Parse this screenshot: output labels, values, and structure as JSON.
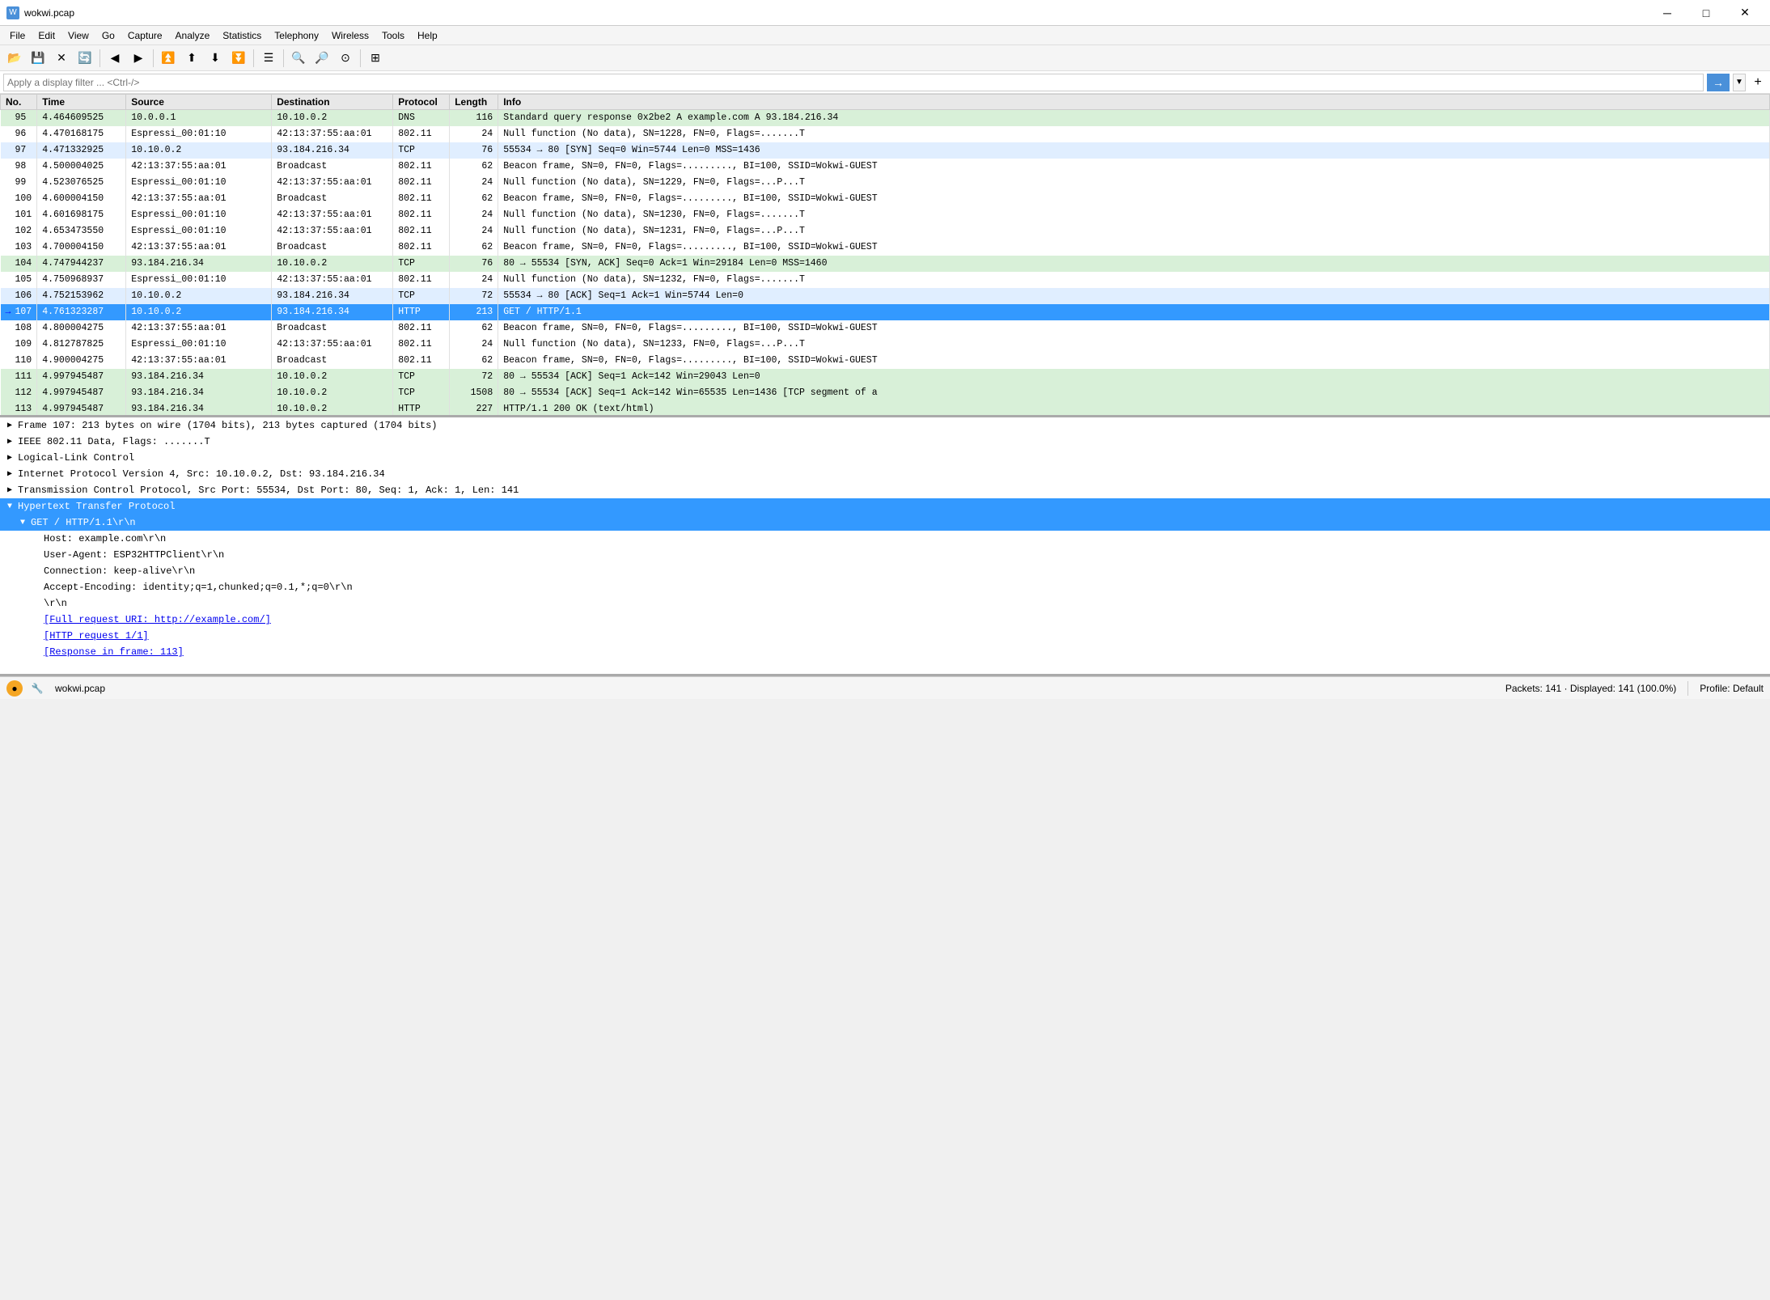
{
  "titlebar": {
    "title": "wokwi.pcap",
    "icon": "W",
    "minimize": "─",
    "maximize": "□",
    "close": "✕"
  },
  "menubar": {
    "items": [
      "File",
      "Edit",
      "View",
      "Go",
      "Capture",
      "Analyze",
      "Statistics",
      "Telephony",
      "Wireless",
      "Tools",
      "Help"
    ]
  },
  "toolbar": {
    "buttons": [
      "📂",
      "💾",
      "✕",
      "🔄",
      "⬅",
      "➡",
      "⬇",
      "⬆",
      "⬇",
      "☰",
      "🔍",
      "🔍",
      "🔍",
      "⊞"
    ]
  },
  "filter": {
    "placeholder": "Apply a display filter ... <Ctrl-/>",
    "value": "",
    "arrow_label": "→",
    "dropdown_label": "▼",
    "add_label": "+"
  },
  "columns": [
    "No.",
    "Time",
    "Source",
    "Destination",
    "Protocol",
    "Length",
    "Info"
  ],
  "packets": [
    {
      "no": "95",
      "time": "4.464609525",
      "src": "10.0.0.1",
      "dst": "10.10.0.2",
      "proto": "DNS",
      "len": "116",
      "info": "Standard query response 0x2be2 A example.com A 93.184.216.34",
      "color": "green",
      "arrow": ""
    },
    {
      "no": "96",
      "time": "4.470168175",
      "src": "Espressi_00:01:10",
      "dst": "42:13:37:55:aa:01",
      "proto": "802.11",
      "len": "24",
      "info": "Null function (No data), SN=1228, FN=0, Flags=.......T",
      "color": "white",
      "arrow": ""
    },
    {
      "no": "97",
      "time": "4.471332925",
      "src": "10.10.0.2",
      "dst": "93.184.216.34",
      "proto": "TCP",
      "len": "76",
      "info": "55534 → 80 [SYN] Seq=0 Win=5744 Len=0 MSS=1436",
      "color": "blue",
      "arrow": ""
    },
    {
      "no": "98",
      "time": "4.500004025",
      "src": "42:13:37:55:aa:01",
      "dst": "Broadcast",
      "proto": "802.11",
      "len": "62",
      "info": "Beacon frame, SN=0, FN=0, Flags=........., BI=100, SSID=Wokwi-GUEST",
      "color": "white",
      "arrow": ""
    },
    {
      "no": "99",
      "time": "4.523076525",
      "src": "Espressi_00:01:10",
      "dst": "42:13:37:55:aa:01",
      "proto": "802.11",
      "len": "24",
      "info": "Null function (No data), SN=1229, FN=0, Flags=...P...T",
      "color": "white",
      "arrow": ""
    },
    {
      "no": "100",
      "time": "4.600004150",
      "src": "42:13:37:55:aa:01",
      "dst": "Broadcast",
      "proto": "802.11",
      "len": "62",
      "info": "Beacon frame, SN=0, FN=0, Flags=........., BI=100, SSID=Wokwi-GUEST",
      "color": "white",
      "arrow": ""
    },
    {
      "no": "101",
      "time": "4.601698175",
      "src": "Espressi_00:01:10",
      "dst": "42:13:37:55:aa:01",
      "proto": "802.11",
      "len": "24",
      "info": "Null function (No data), SN=1230, FN=0, Flags=.......T",
      "color": "white",
      "arrow": ""
    },
    {
      "no": "102",
      "time": "4.653473550",
      "src": "Espressi_00:01:10",
      "dst": "42:13:37:55:aa:01",
      "proto": "802.11",
      "len": "24",
      "info": "Null function (No data), SN=1231, FN=0, Flags=...P...T",
      "color": "white",
      "arrow": ""
    },
    {
      "no": "103",
      "time": "4.700004150",
      "src": "42:13:37:55:aa:01",
      "dst": "Broadcast",
      "proto": "802.11",
      "len": "62",
      "info": "Beacon frame, SN=0, FN=0, Flags=........., BI=100, SSID=Wokwi-GUEST",
      "color": "white",
      "arrow": ""
    },
    {
      "no": "104",
      "time": "4.747944237",
      "src": "93.184.216.34",
      "dst": "10.10.0.2",
      "proto": "TCP",
      "len": "76",
      "info": "80 → 55534 [SYN, ACK] Seq=0 Ack=1 Win=29184 Len=0 MSS=1460",
      "color": "green",
      "arrow": ""
    },
    {
      "no": "105",
      "time": "4.750968937",
      "src": "Espressi_00:01:10",
      "dst": "42:13:37:55:aa:01",
      "proto": "802.11",
      "len": "24",
      "info": "Null function (No data), SN=1232, FN=0, Flags=.......T",
      "color": "white",
      "arrow": ""
    },
    {
      "no": "106",
      "time": "4.752153962",
      "src": "10.10.0.2",
      "dst": "93.184.216.34",
      "proto": "TCP",
      "len": "72",
      "info": "55534 → 80 [ACK] Seq=1 Ack=1 Win=5744 Len=0",
      "color": "blue",
      "arrow": ""
    },
    {
      "no": "107",
      "time": "4.761323287",
      "src": "10.10.0.2",
      "dst": "93.184.216.34",
      "proto": "HTTP",
      "len": "213",
      "info": "GET / HTTP/1.1",
      "color": "selected",
      "arrow": "→"
    },
    {
      "no": "108",
      "time": "4.800004275",
      "src": "42:13:37:55:aa:01",
      "dst": "Broadcast",
      "proto": "802.11",
      "len": "62",
      "info": "Beacon frame, SN=0, FN=0, Flags=........., BI=100, SSID=Wokwi-GUEST",
      "color": "white",
      "arrow": ""
    },
    {
      "no": "109",
      "time": "4.812787825",
      "src": "Espressi_00:01:10",
      "dst": "42:13:37:55:aa:01",
      "proto": "802.11",
      "len": "24",
      "info": "Null function (No data), SN=1233, FN=0, Flags=...P...T",
      "color": "white",
      "arrow": ""
    },
    {
      "no": "110",
      "time": "4.900004275",
      "src": "42:13:37:55:aa:01",
      "dst": "Broadcast",
      "proto": "802.11",
      "len": "62",
      "info": "Beacon frame, SN=0, FN=0, Flags=........., BI=100, SSID=Wokwi-GUEST",
      "color": "white",
      "arrow": ""
    },
    {
      "no": "111",
      "time": "4.997945487",
      "src": "93.184.216.34",
      "dst": "10.10.0.2",
      "proto": "TCP",
      "len": "72",
      "info": "80 → 55534 [ACK] Seq=1 Ack=142 Win=29043 Len=0",
      "color": "green",
      "arrow": ""
    },
    {
      "no": "112",
      "time": "4.997945487",
      "src": "93.184.216.34",
      "dst": "10.10.0.2",
      "proto": "TCP",
      "len": "1508",
      "info": "80 → 55534 [ACK] Seq=1 Ack=142 Win=65535 Len=1436 [TCP segment of a",
      "color": "green",
      "arrow": ""
    },
    {
      "no": "113",
      "time": "4.997945487",
      "src": "93.184.216.34",
      "dst": "10.10.0.2",
      "proto": "HTTP",
      "len": "227",
      "info": "HTTP/1.1 200 OK  (text/html)",
      "color": "green",
      "arrow": ""
    }
  ],
  "detail": {
    "sections": [
      {
        "id": "frame",
        "label": "Frame 107: 213 bytes on wire (1704 bits), 213 bytes captured (1704 bits)",
        "expanded": false,
        "indent": 0
      },
      {
        "id": "ieee",
        "label": "IEEE 802.11 Data, Flags: .......T",
        "expanded": false,
        "indent": 0
      },
      {
        "id": "llc",
        "label": "Logical-Link Control",
        "expanded": false,
        "indent": 0
      },
      {
        "id": "ip",
        "label": "Internet Protocol Version 4, Src: 10.10.0.2, Dst: 93.184.216.34",
        "expanded": false,
        "indent": 0
      },
      {
        "id": "tcp",
        "label": "Transmission Control Protocol, Src Port: 55534, Dst Port: 80, Seq: 1, Ack: 1, Len: 141",
        "expanded": false,
        "indent": 0
      },
      {
        "id": "http",
        "label": "Hypertext Transfer Protocol",
        "expanded": true,
        "indent": 0,
        "selected": true
      }
    ],
    "http_children": [
      {
        "id": "http-request-line",
        "label": "GET / HTTP/1.1\\r\\n",
        "expanded": true,
        "indent": 1,
        "selected": true
      },
      {
        "id": "http-host",
        "label": "Host: example.com\\r\\n",
        "indent": 2,
        "is_text": true
      },
      {
        "id": "http-useragent",
        "label": "User-Agent: ESP32HTTPClient\\r\\n",
        "indent": 2,
        "is_text": true
      },
      {
        "id": "http-connection",
        "label": "Connection: keep-alive\\r\\n",
        "indent": 2,
        "is_text": true
      },
      {
        "id": "http-accept",
        "label": "Accept-Encoding: identity;q=1,chunked;q=0.1,*;q=0\\r\\n",
        "indent": 2,
        "is_text": true
      },
      {
        "id": "http-empty",
        "label": "\\r\\n",
        "indent": 2,
        "is_text": true
      },
      {
        "id": "http-full-uri",
        "label": "[Full request URI: http://example.com/]",
        "indent": 2,
        "is_link": true
      },
      {
        "id": "http-request",
        "label": "[HTTP request 1/1]",
        "indent": 2,
        "is_link": true
      },
      {
        "id": "http-response",
        "label": "[Response in frame: 113]",
        "indent": 2,
        "is_link": true
      }
    ]
  },
  "statusbar": {
    "filename": "wokwi.pcap",
    "packets_info": "Packets: 141 · Displayed: 141 (100.0%)",
    "profile": "Profile: Default"
  }
}
